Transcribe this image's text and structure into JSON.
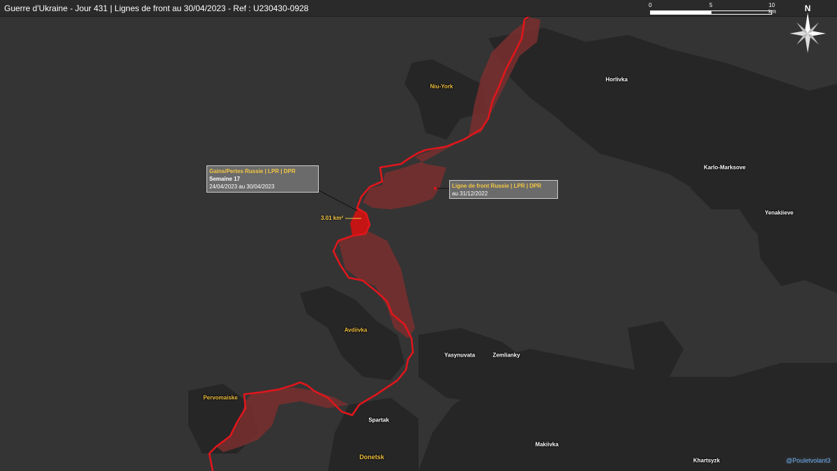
{
  "header": {
    "title": "Guerre d'Ukraine - Jour 431 | Lignes de front au 30/04/2023 - Ref : U230430-0928"
  },
  "scale_bar": {
    "labels": [
      "0",
      "5",
      "10 km"
    ]
  },
  "compass": {
    "north_label": "N"
  },
  "places": [
    {
      "name": "Horlivka",
      "style": "white"
    },
    {
      "name": "Niu-York",
      "style": "orange"
    },
    {
      "name": "Karlo-Marksove",
      "style": "white"
    },
    {
      "name": "Yenakiieve",
      "style": "white"
    },
    {
      "name": "Avdiivka",
      "style": "orange"
    },
    {
      "name": "Yasynuvata",
      "style": "white"
    },
    {
      "name": "Zemlianky",
      "style": "white"
    },
    {
      "name": "Pervomaiske",
      "style": "orange"
    },
    {
      "name": "Spartak",
      "style": "white"
    },
    {
      "name": "Makiivka",
      "style": "white"
    },
    {
      "name": "Donetsk",
      "style": "orange"
    },
    {
      "name": "Khartsyzk",
      "style": "white"
    }
  ],
  "legend_gains": {
    "heading": "Gains/Pertes Russie | LPR | DPR",
    "week": "Semaine 17",
    "dates": "24/04/2023 au 30/04/2023"
  },
  "legend_frontline": {
    "heading": "Ligne de front Russie | LPR | DPR",
    "date": "au 31/12/2022"
  },
  "area_label": "3.01 km²",
  "credit": "@Pouletvolant3",
  "colors": {
    "background": "#343434",
    "urban": "#262626",
    "front_line": "#e0161c",
    "occupied_area": "#7a2f2f",
    "gain_area": "#b31212",
    "accent_text": "#f5c842",
    "credit_text": "#6fb4ff"
  }
}
